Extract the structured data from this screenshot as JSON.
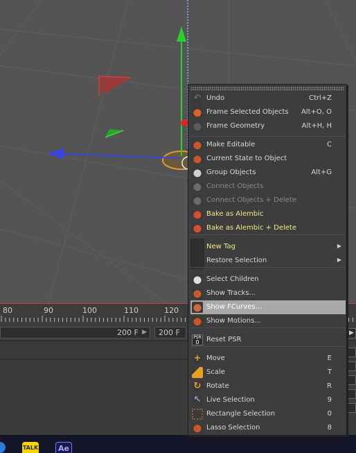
{
  "timeline": {
    "labels": [
      "80",
      "90",
      "100",
      "110",
      "120"
    ]
  },
  "frame_row": {
    "end_frame_a": "200 F",
    "end_frame_b": "200 F"
  },
  "taskbar": {
    "talk_label": "TALK",
    "ae_label": "Ae"
  },
  "menu": {
    "items": [
      {
        "label": "Undo",
        "shortcut": "Ctrl+Z",
        "icon": "undo-icon"
      },
      {
        "label": "Frame Selected Objects",
        "shortcut": "Alt+O, O",
        "icon": "frame-selected-icon"
      },
      {
        "label": "Frame Geometry",
        "shortcut": "Alt+H, H",
        "icon": "frame-geometry-icon"
      },
      {
        "label": "Make Editable",
        "shortcut": "C",
        "icon": "make-editable-icon"
      },
      {
        "label": "Current State to Object",
        "shortcut": "",
        "icon": "current-state-icon"
      },
      {
        "label": "Group Objects",
        "shortcut": "Alt+G",
        "icon": "group-objects-icon"
      },
      {
        "label": "Connect Objects",
        "shortcut": "",
        "icon": "connect-objects-icon"
      },
      {
        "label": "Connect Objects + Delete",
        "shortcut": "",
        "icon": "connect-delete-icon"
      },
      {
        "label": "Bake as Alembic",
        "shortcut": "",
        "icon": "alembic-icon"
      },
      {
        "label": "Bake as Alembic + Delete",
        "shortcut": "",
        "icon": "alembic-delete-icon"
      },
      {
        "label": "New Tag",
        "shortcut": "",
        "icon": ""
      },
      {
        "label": "Restore Selection",
        "shortcut": "",
        "icon": ""
      },
      {
        "label": "Select Children",
        "shortcut": "",
        "icon": "select-children-icon"
      },
      {
        "label": "Show Tracks...",
        "shortcut": "",
        "icon": "show-tracks-icon"
      },
      {
        "label": "Show FCurves...",
        "shortcut": "",
        "icon": "show-fcurves-icon"
      },
      {
        "label": "Show Motions...",
        "shortcut": "",
        "icon": "show-motions-icon"
      },
      {
        "label": "Reset PSR",
        "shortcut": "",
        "icon": "reset-psr-icon"
      },
      {
        "label": "Move",
        "shortcut": "E",
        "icon": "move-icon"
      },
      {
        "label": "Scale",
        "shortcut": "T",
        "icon": "scale-icon"
      },
      {
        "label": "Rotate",
        "shortcut": "R",
        "icon": "rotate-icon"
      },
      {
        "label": "Live Selection",
        "shortcut": "9",
        "icon": "live-selection-icon"
      },
      {
        "label": "Rectangle Selection",
        "shortcut": "0",
        "icon": "rectangle-selection-icon"
      },
      {
        "label": "Lasso Selection",
        "shortcut": "8",
        "icon": "lasso-selection-icon"
      }
    ],
    "psr_icon_text": "PSR",
    "psr_icon_sub": "0"
  }
}
